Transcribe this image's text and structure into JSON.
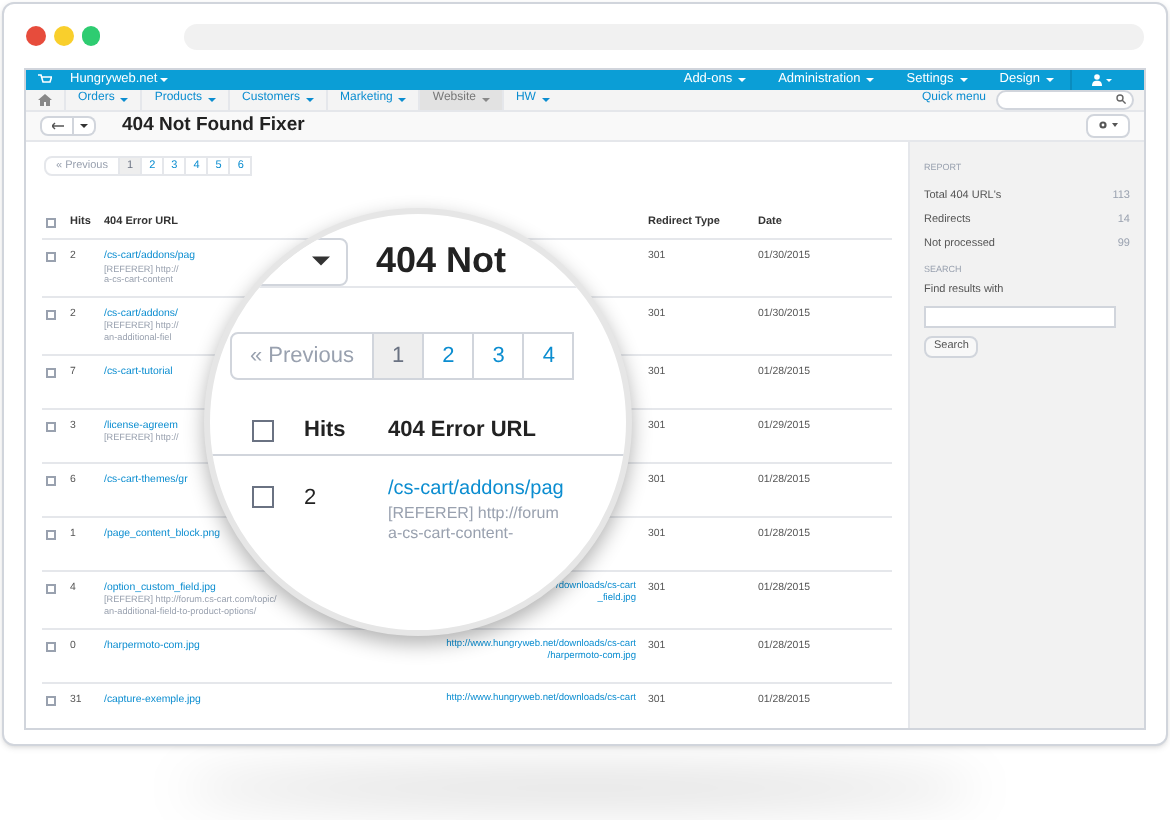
{
  "top_bar": {
    "store": "Hungryweb.net",
    "menus": [
      "Add-ons",
      "Administration",
      "Settings",
      "Design"
    ]
  },
  "nav": {
    "items": [
      {
        "label": "Orders",
        "selected": false
      },
      {
        "label": "Products",
        "selected": false
      },
      {
        "label": "Customers",
        "selected": false
      },
      {
        "label": "Marketing",
        "selected": false
      },
      {
        "label": "Website",
        "selected": true
      },
      {
        "label": "HW",
        "selected": false
      }
    ],
    "quick_menu": "Quick menu"
  },
  "page": {
    "title": "404 Not Found Fixer"
  },
  "pagination": [
    {
      "label": "« Previous",
      "selected": false
    },
    {
      "label": "1",
      "selected": true
    },
    {
      "label": "2",
      "selected": false
    },
    {
      "label": "3",
      "selected": false
    },
    {
      "label": "4",
      "selected": false
    },
    {
      "label": "5",
      "selected": false
    },
    {
      "label": "6",
      "selected": false
    }
  ],
  "table": {
    "select_all_checked": false,
    "columns": [
      "Hits",
      "404 Error URL",
      "Redirect Type",
      "Date"
    ],
    "rows": [
      {
        "checked": false,
        "hits": "2",
        "url": "/cs-cart/addons/pag",
        "referer": [
          "[REFERER] http://",
          "a-cs-cart-content"
        ],
        "redirect": [],
        "type": "301",
        "date": "01/30/2015"
      },
      {
        "checked": false,
        "hits": "2",
        "url": "/cs-cart/addons/",
        "referer": [
          "[REFERER] http://",
          "an-additional-fiel"
        ],
        "redirect": [],
        "type": "301",
        "date": "01/30/2015"
      },
      {
        "checked": false,
        "hits": "7",
        "url": "/cs-cart-tutorial",
        "referer": [],
        "redirect": [],
        "type": "301",
        "date": "01/28/2015"
      },
      {
        "checked": false,
        "hits": "3",
        "url": "/license-agreem",
        "referer": [
          "[REFERER] http://"
        ],
        "redirect": [],
        "type": "301",
        "date": "01/29/2015"
      },
      {
        "checked": false,
        "hits": "6",
        "url": "/cs-cart-themes/gr",
        "referer": [],
        "redirect": [],
        "type": "301",
        "date": "01/28/2015"
      },
      {
        "checked": false,
        "hits": "1",
        "url": "/page_content_block.png",
        "referer": [],
        "redirect": [],
        "type": "301",
        "date": "01/28/2015"
      },
      {
        "checked": false,
        "hits": "4",
        "url": "/option_custom_field.jpg",
        "referer": [
          "[REFERER] http://forum.cs-cart.com/topic/",
          "an-additional-field-to-product-options/"
        ],
        "redirect": [
          "/downloads/cs-cart",
          "_field.jpg"
        ],
        "type": "301",
        "date": "01/28/2015"
      },
      {
        "checked": false,
        "hits": "0",
        "url": "/harpermoto-com.jpg",
        "referer": [],
        "redirect": [
          "http://www.hungryweb.net/downloads/cs-cart",
          "/harpermoto-com.jpg"
        ],
        "type": "301",
        "date": "01/28/2015"
      },
      {
        "checked": false,
        "hits": "31",
        "url": "/capture-exemple.jpg",
        "referer": [],
        "redirect": [
          "http://www.hungryweb.net/downloads/cs-cart"
        ],
        "type": "301",
        "date": "01/28/2015"
      }
    ]
  },
  "sidebar": {
    "report_heading": "REPORT",
    "stats": [
      {
        "label": "Total 404 URL's",
        "value": "113"
      },
      {
        "label": "Redirects",
        "value": "14"
      },
      {
        "label": "Not processed",
        "value": "99"
      }
    ],
    "search_heading": "SEARCH",
    "search_label": "Find results with",
    "button": "Search"
  },
  "magnifier": {
    "select_all_checked": false,
    "title": "404 Not",
    "pagination": [
      {
        "label": "« Previous",
        "selected": false
      },
      {
        "label": "1",
        "selected": true
      },
      {
        "label": "2",
        "selected": false
      },
      {
        "label": "3",
        "selected": false
      },
      {
        "label": "4",
        "selected": false
      }
    ],
    "columns": [
      "Hits",
      "404 Error URL"
    ],
    "row": {
      "checked": false,
      "hits": "2",
      "url": "/cs-cart/addons/pag",
      "referer": [
        "[REFERER] http://forum",
        "a-cs-cart-content-"
      ]
    }
  }
}
